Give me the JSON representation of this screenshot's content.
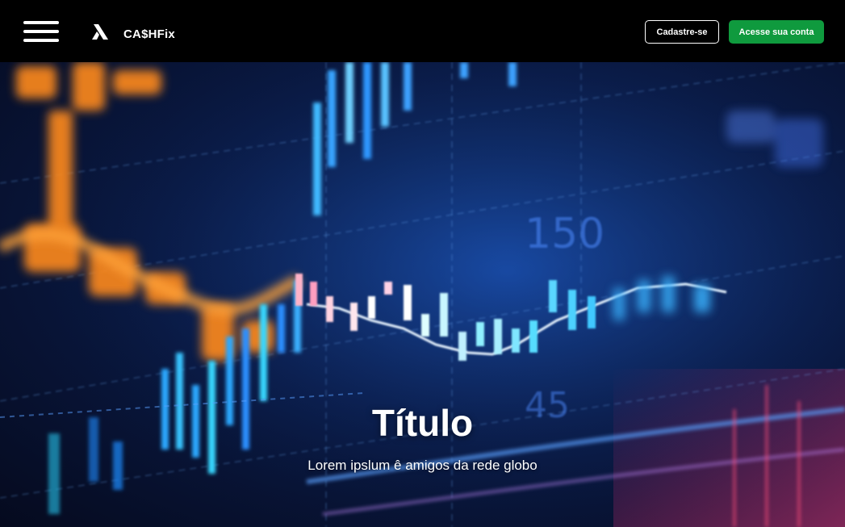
{
  "header": {
    "brand_name": "CA$HFix",
    "signup_label": "Cadastre-se",
    "login_label": "Acesse sua conta",
    "menu_icon": "hamburger-menu-icon",
    "logo_icon": "brand-logo-icon"
  },
  "hero": {
    "title": "Título",
    "subtitle": "Lorem ipslum ê amigos da rede globo",
    "background_label_1": "150",
    "background_label_2": "45"
  },
  "colors": {
    "header_bg": "#000000",
    "accent_green": "#0f9a3e",
    "hero_blue": "#0a1a45",
    "candle_orange": "#ff8a1f",
    "candle_cyan": "#39d7ff"
  }
}
